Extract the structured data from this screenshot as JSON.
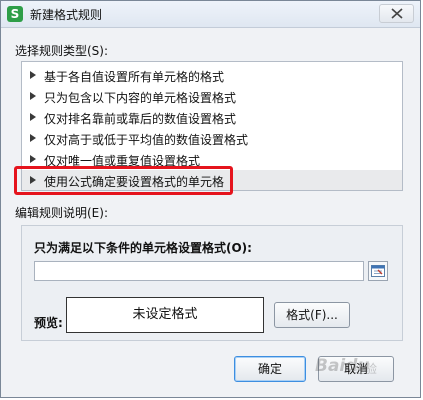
{
  "window": {
    "app_icon_letter": "S",
    "title": "新建格式规则"
  },
  "rule_type": {
    "label": "选择规则类型(S):",
    "items": [
      {
        "label": "基于各自值设置所有单元格的格式"
      },
      {
        "label": "只为包含以下内容的单元格设置格式"
      },
      {
        "label": "仅对排名靠前或靠后的数值设置格式"
      },
      {
        "label": "仅对高于或低于平均值的数值设置格式"
      },
      {
        "label": "仅对唯一值或重复值设置格式"
      },
      {
        "label": "使用公式确定要设置格式的单元格",
        "selected": true
      }
    ]
  },
  "edit": {
    "label": "编辑规则说明(E):",
    "condition_label": "只为满足以下条件的单元格设置格式(O):",
    "formula_value": "",
    "preview_label": "预览:",
    "preview_text": "未设定格式",
    "format_button": "格式(F)..."
  },
  "buttons": {
    "ok": "确定",
    "cancel": "取消"
  },
  "watermark": {
    "text": "Baidu",
    "sub": "经验"
  },
  "colors": {
    "highlight": "#e5141d",
    "ok_border": "#3d8ee0",
    "app_icon": "#2e9e48"
  }
}
